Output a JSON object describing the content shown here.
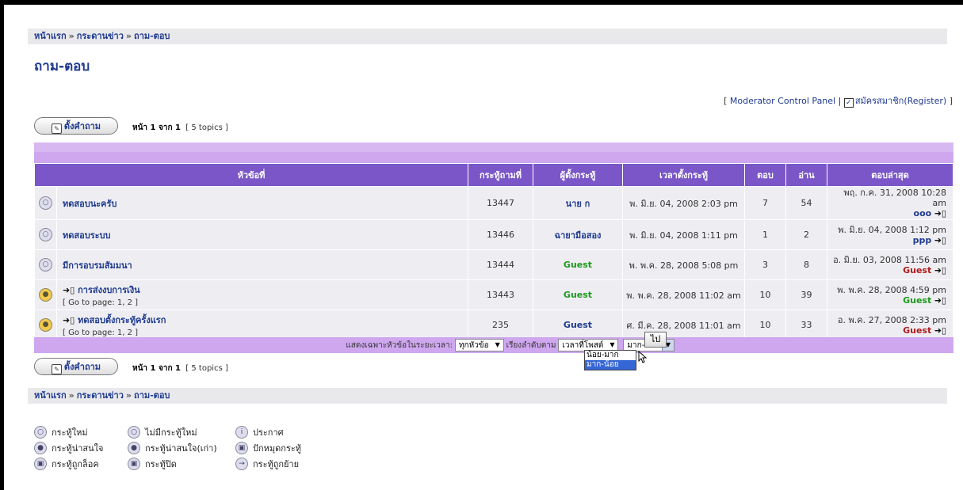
{
  "breadcrumb": {
    "home": "หน้าแรก",
    "sep": "»",
    "board": "กระดานข่าว",
    "forum": "ถาม-ตอบ"
  },
  "page_title": "ถาม-ตอบ",
  "top_links": {
    "open": "[",
    "moderator": "Moderator Control Panel",
    "divider": "|",
    "register": "สมัครสมาชิก(Register)",
    "close": "]"
  },
  "post_button": "ตั้งคำถาม",
  "page_info": {
    "label": "หน้า 1 จาก 1",
    "topics": "[ 5 topics ]"
  },
  "columns": [
    "หัวข้อที่",
    "กระทู้ถามที่",
    "ผู้ตั้งกระทู้",
    "เวลาตั้งกระทู้",
    "ตอบ",
    "อ่าน",
    "ตอบล่าสุด"
  ],
  "topics": [
    {
      "title": "ทดสอบนะครับ",
      "goto": "",
      "id": "13447",
      "author": "นาย ก",
      "author_color": "#1f3a8f",
      "time": "พ. มิ.ย. 04, 2008 2:03 pm",
      "replies": "7",
      "views": "54",
      "last_time": "พฤ. ก.ค. 31, 2008 10:28 am",
      "last_user": "ooo",
      "last_color": "#1f3a8f",
      "hot": false
    },
    {
      "title": "ทดสอบระบบ",
      "goto": "",
      "id": "13446",
      "author": "ฉายามือสอง",
      "author_color": "#1f3a8f",
      "time": "พ. มิ.ย. 04, 2008 1:11 pm",
      "replies": "1",
      "views": "2",
      "last_time": "พ. มิ.ย. 04, 2008 1:12 pm",
      "last_user": "ppp",
      "last_color": "#1f3a8f",
      "hot": false
    },
    {
      "title": "มีการอบรมสัมมนา",
      "goto": "",
      "id": "13444",
      "author": "Guest",
      "author_color": "#1a9a1a",
      "time": "พ. พ.ค. 28, 2008 5:08 pm",
      "replies": "3",
      "views": "8",
      "last_time": "อ. มิ.ย. 03, 2008 11:56 am",
      "last_user": "Guest",
      "last_color": "#b01b1b",
      "hot": false
    },
    {
      "title": "การส่งงบการเงิน",
      "goto": "[ Go to page: 1, 2 ]",
      "id": "13443",
      "author": "Guest",
      "author_color": "#1a9a1a",
      "time": "พ. พ.ค. 28, 2008 11:02 am",
      "replies": "10",
      "views": "39",
      "last_time": "พ. พ.ค. 28, 2008 4:59 pm",
      "last_user": "Guest",
      "last_color": "#1a9a1a",
      "hot": true
    },
    {
      "title": "ทดสอบตั้งกระทู้ครั้งแรก",
      "goto": "[ Go to page: 1, 2 ]",
      "id": "235",
      "author": "Guest",
      "author_color": "#1f3a8f",
      "time": "ศ. มี.ค. 28, 2008 11:01 am",
      "replies": "10",
      "views": "33",
      "last_time": "อ. พ.ค. 27, 2008 2:33 pm",
      "last_user": "Guest",
      "last_color": "#b01b1b",
      "hot": true
    }
  ],
  "sort": {
    "show_label": "แสดงเฉพาะหัวข้อในระยะเวลา:",
    "period": "ทุกหัวข้อ",
    "order_label": "เรียงลำดับตาม",
    "order_by": "เวลาที่โพสต์",
    "direction": "มาก-น้อย",
    "go": "ไป",
    "options": [
      "น้อย-มาก",
      "มาก-น้อย"
    ]
  },
  "legend": [
    [
      "กระทู้ใหม่",
      "ไม่มีกระทู้ใหม่",
      "ประกาศ"
    ],
    [
      "กระทู้น่าสนใจ",
      "กระทู้น่าสนใจ(เก่า)",
      "ปักหมุดกระทู้"
    ],
    [
      "กระทู้ถูกล็อค",
      "กระทู้ปิด",
      "กระทู้ถูกย้าย"
    ]
  ]
}
